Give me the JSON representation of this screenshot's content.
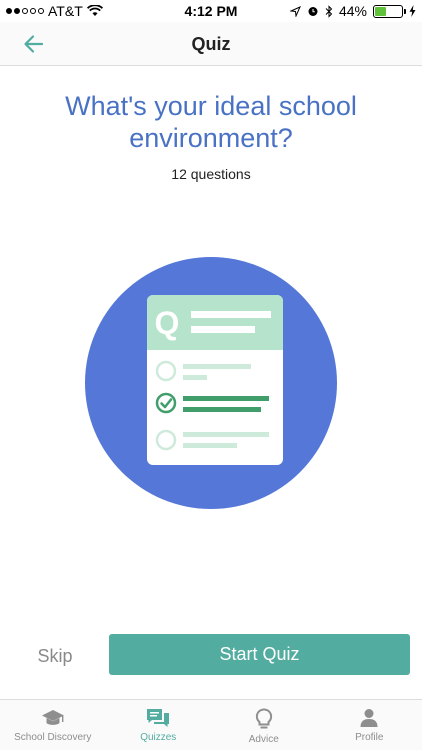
{
  "status_bar": {
    "carrier": "AT&T",
    "time": "4:12 PM",
    "battery": "44%",
    "battery_level": 0.44
  },
  "nav": {
    "title": "Quiz"
  },
  "quiz": {
    "title": "What's your ideal school environment?",
    "question_count": "12 questions",
    "card_letter": "Q"
  },
  "actions": {
    "skip_label": "Skip",
    "start_label": "Start Quiz"
  },
  "tabs": [
    {
      "label": "School Discovery",
      "icon": "graduation-cap-icon",
      "active": false
    },
    {
      "label": "Quizzes",
      "icon": "chat-bubbles-icon",
      "active": true
    },
    {
      "label": "Advice",
      "icon": "lightbulb-icon",
      "active": false
    },
    {
      "label": "Profile",
      "icon": "person-icon",
      "active": false
    }
  ],
  "colors": {
    "accent": "#52aca0",
    "title_blue": "#4a72c4",
    "circle_blue": "#5578d8",
    "card_header": "#b5e3cc",
    "check_green": "#3f9e6a"
  }
}
